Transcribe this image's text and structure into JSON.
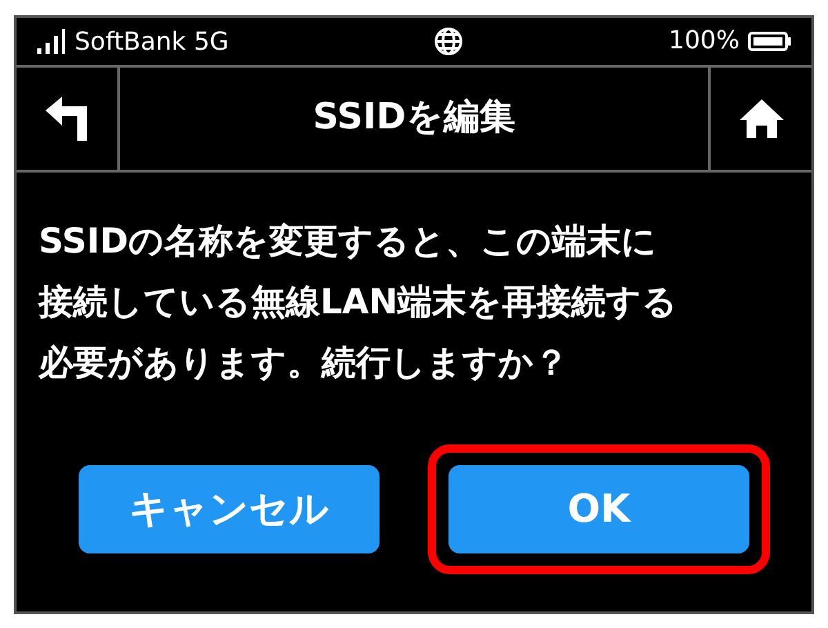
{
  "status_bar": {
    "carrier": "SoftBank 5G",
    "battery": "100%"
  },
  "header": {
    "title": "SSIDを編集"
  },
  "message": "SSIDの名称を変更すると、この端末に接続している無線LAN端末を再接続する必要があります。続行しますか？",
  "buttons": [
    {
      "label": "キャンセル",
      "highlighted": false
    },
    {
      "label": "OK",
      "highlighted": true
    }
  ]
}
